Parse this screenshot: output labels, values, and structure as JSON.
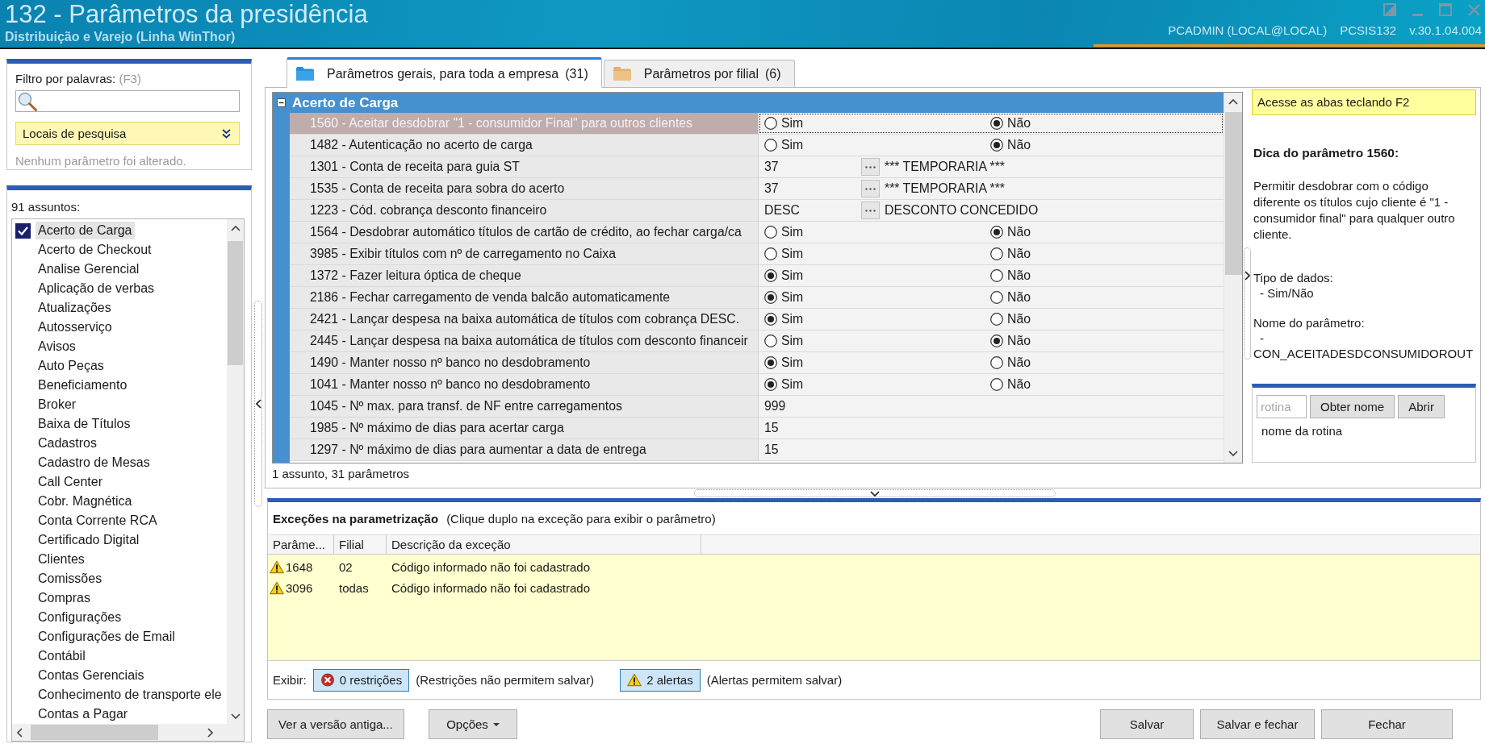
{
  "window": {
    "title": "132 - Parâmetros da presidência",
    "subtitle": "Distribuição e Varejo (Linha WinThor)",
    "user": "PCADMIN (LOCAL@LOCAL)",
    "program": "PCSIS132",
    "version": "v.30.1.04.004"
  },
  "filter": {
    "label": "Filtro por palavras:",
    "shortcut": "(F3)",
    "search_locations": "Locais de pesquisa",
    "status": "Nenhum parâmetro foi alterado."
  },
  "subjects": {
    "label": "91 assuntos:",
    "items": [
      {
        "label": "Acerto de Carga",
        "selected": true,
        "checked": true
      },
      {
        "label": "Acerto de Checkout",
        "selected": false,
        "checked": false
      },
      {
        "label": "Analise Gerencial",
        "selected": false,
        "checked": false
      },
      {
        "label": "Aplicação de verbas",
        "selected": false,
        "checked": false
      },
      {
        "label": "Atualizações",
        "selected": false,
        "checked": false
      },
      {
        "label": "Autosserviço",
        "selected": false,
        "checked": false
      },
      {
        "label": "Avisos",
        "selected": false,
        "checked": false
      },
      {
        "label": "Auto Peças",
        "selected": false,
        "checked": false
      },
      {
        "label": "Beneficiamento",
        "selected": false,
        "checked": false
      },
      {
        "label": "Broker",
        "selected": false,
        "checked": false
      },
      {
        "label": "Baixa de Títulos",
        "selected": false,
        "checked": false
      },
      {
        "label": "Cadastros",
        "selected": false,
        "checked": false
      },
      {
        "label": "Cadastro de Mesas",
        "selected": false,
        "checked": false
      },
      {
        "label": "Call Center",
        "selected": false,
        "checked": false
      },
      {
        "label": "Cobr. Magnética",
        "selected": false,
        "checked": false
      },
      {
        "label": "Conta Corrente RCA",
        "selected": false,
        "checked": false
      },
      {
        "label": "Certificado Digital",
        "selected": false,
        "checked": false
      },
      {
        "label": "Clientes",
        "selected": false,
        "checked": false
      },
      {
        "label": "Comissões",
        "selected": false,
        "checked": false
      },
      {
        "label": "Compras",
        "selected": false,
        "checked": false
      },
      {
        "label": "Configurações",
        "selected": false,
        "checked": false
      },
      {
        "label": "Configurações de Email",
        "selected": false,
        "checked": false
      },
      {
        "label": "Contábil",
        "selected": false,
        "checked": false
      },
      {
        "label": "Contas Gerenciais",
        "selected": false,
        "checked": false
      },
      {
        "label": "Conhecimento de transporte ele",
        "selected": false,
        "checked": false
      },
      {
        "label": "Contas a Pagar",
        "selected": false,
        "checked": false
      }
    ]
  },
  "tabs": [
    {
      "label": "Parâmetros gerais, para toda a empresa",
      "count": "(31)",
      "selected": true
    },
    {
      "label": "Parâmetros por filial",
      "count": "(6)",
      "selected": false
    }
  ],
  "grid": {
    "group": {
      "title": "Acerto de Carga",
      "expanded": true
    },
    "rows": [
      {
        "label": "1560 - Aceitar desdobrar \"1 - consumidor Final\" para outros clientes",
        "kind": "yesno",
        "selected": true,
        "options": [
          {
            "label": "Sim",
            "selected": false
          },
          {
            "label": "Não",
            "selected": true
          }
        ]
      },
      {
        "label": "1482 - Autenticação no acerto de carga",
        "kind": "yesno",
        "selected": false,
        "options": [
          {
            "label": "Sim",
            "selected": false
          },
          {
            "label": "Não",
            "selected": true
          }
        ]
      },
      {
        "label": "1301 - Conta de receita para guia ST",
        "kind": "lookup",
        "selected": false,
        "value": "37",
        "description": "*** TEMPORARIA ***"
      },
      {
        "label": "1535 - Conta de receita para sobra do acerto",
        "kind": "lookup",
        "selected": false,
        "value": "37",
        "description": "*** TEMPORARIA ***"
      },
      {
        "label": "1223 - Cód. cobrança desconto financeiro",
        "kind": "lookup",
        "selected": false,
        "value": "DESC",
        "description": "DESCONTO CONCEDIDO"
      },
      {
        "label": "1564 - Desdobrar automático títulos de cartão de crédito, ao fechar carga/ca",
        "kind": "yesno",
        "selected": false,
        "options": [
          {
            "label": "Sim",
            "selected": false
          },
          {
            "label": "Não",
            "selected": true
          }
        ]
      },
      {
        "label": "3985 - Exibir títulos com nº de carregamento no Caixa",
        "kind": "yesno",
        "selected": false,
        "options": [
          {
            "label": "Sim",
            "selected": false
          },
          {
            "label": "Não",
            "selected": false
          }
        ]
      },
      {
        "label": "1372 - Fazer leitura óptica de cheque",
        "kind": "yesno",
        "selected": false,
        "options": [
          {
            "label": "Sim",
            "selected": true
          },
          {
            "label": "Não",
            "selected": false
          }
        ]
      },
      {
        "label": "2186 - Fechar carregamento de venda balcão automaticamente",
        "kind": "yesno",
        "selected": false,
        "options": [
          {
            "label": "Sim",
            "selected": true
          },
          {
            "label": "Não",
            "selected": false
          }
        ]
      },
      {
        "label": "2421 - Lançar despesa na baixa automática de títulos com cobrança DESC.",
        "kind": "yesno",
        "selected": false,
        "options": [
          {
            "label": "Sim",
            "selected": true
          },
          {
            "label": "Não",
            "selected": false
          }
        ]
      },
      {
        "label": "2445 - Lançar despesa na baixa automática de títulos com desconto financeir",
        "kind": "yesno",
        "selected": false,
        "options": [
          {
            "label": "Sim",
            "selected": false
          },
          {
            "label": "Não",
            "selected": true
          }
        ]
      },
      {
        "label": "1490 - Manter nosso nº banco no desdobramento",
        "kind": "yesno",
        "selected": false,
        "options": [
          {
            "label": "Sim",
            "selected": true
          },
          {
            "label": "Não",
            "selected": false
          }
        ]
      },
      {
        "label": "1041 - Manter nosso nº banco no desdobramento",
        "kind": "yesno",
        "selected": false,
        "options": [
          {
            "label": "Sim",
            "selected": true
          },
          {
            "label": "Não",
            "selected": false
          }
        ]
      },
      {
        "label": "1045 - Nº max. para transf. de NF entre carregamentos",
        "kind": "number",
        "selected": false,
        "value": "999"
      },
      {
        "label": "1985 - Nº máximo de dias para acertar carga",
        "kind": "number",
        "selected": false,
        "value": "15"
      },
      {
        "label": "1297 - Nº máximo de dias para aumentar a data de entrega",
        "kind": "number",
        "selected": false,
        "value": "15"
      }
    ]
  },
  "status": "1 assunto, 31 parâmetros",
  "tip": {
    "hint": "Acesse as abas teclando F2",
    "title": "Dica do parâmetro 1560:",
    "description": "Permitir desdobrar com o código diferente os títulos cujo cliente é \"1 - consumidor final\" para qualquer outro cliente.",
    "data_type": {
      "label": "Tipo de dados:",
      "value": "- Sim/Não"
    },
    "parameter_name": {
      "label": "Nome do parâmetro:",
      "lines": [
        "-",
        "CON_ACEITADESDCONSUMIDOROUT"
      ]
    }
  },
  "routine": {
    "placeholder": "rotina",
    "buttons": [
      "Obter nome",
      "Abrir"
    ],
    "name": "nome da rotina"
  },
  "exceptions": {
    "title": "Exceções na parametrização",
    "hint": "(Clique duplo na exceção para exibir o parâmetro)",
    "columns": [
      "Parâme...",
      "Filial",
      "Descrição da exceção"
    ],
    "rows": [
      {
        "kind": "alert",
        "parameter": "1648",
        "branch": "02",
        "description": "Código informado não foi cadastrado"
      },
      {
        "kind": "alert",
        "parameter": "3096",
        "branch": "todas",
        "description": "Código informado não foi cadastrado"
      }
    ],
    "show_label": "Exibir:",
    "toggles": [
      {
        "kind": "restriction",
        "label": "0 restrições",
        "note": "(Restrições não permitem salvar)",
        "selected": true
      },
      {
        "kind": "alert",
        "label": "2 alertas",
        "note": "(Alertas permitem salvar)",
        "selected": true
      }
    ]
  },
  "buttons": {
    "left": [
      {
        "label": "Ver a versão antiga...",
        "kind": "plain"
      },
      {
        "label": "Opções",
        "kind": "menu"
      }
    ],
    "right": [
      "Salvar",
      "Salvar e fechar",
      "Fechar"
    ]
  }
}
